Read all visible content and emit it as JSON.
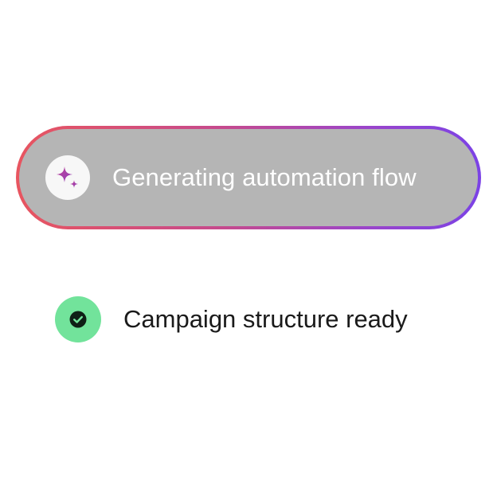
{
  "progress_pill": {
    "label": "Generating automation flow",
    "icon": "sparkle-icon",
    "gradient_colors": [
      "#e8555f",
      "#c54a8e",
      "#9b45c9",
      "#7b42e6"
    ],
    "fill_color": "#b5b5b5"
  },
  "status_item": {
    "label": "Campaign structure ready",
    "icon": "check-circle-icon",
    "accent_color": "#72e39b"
  }
}
